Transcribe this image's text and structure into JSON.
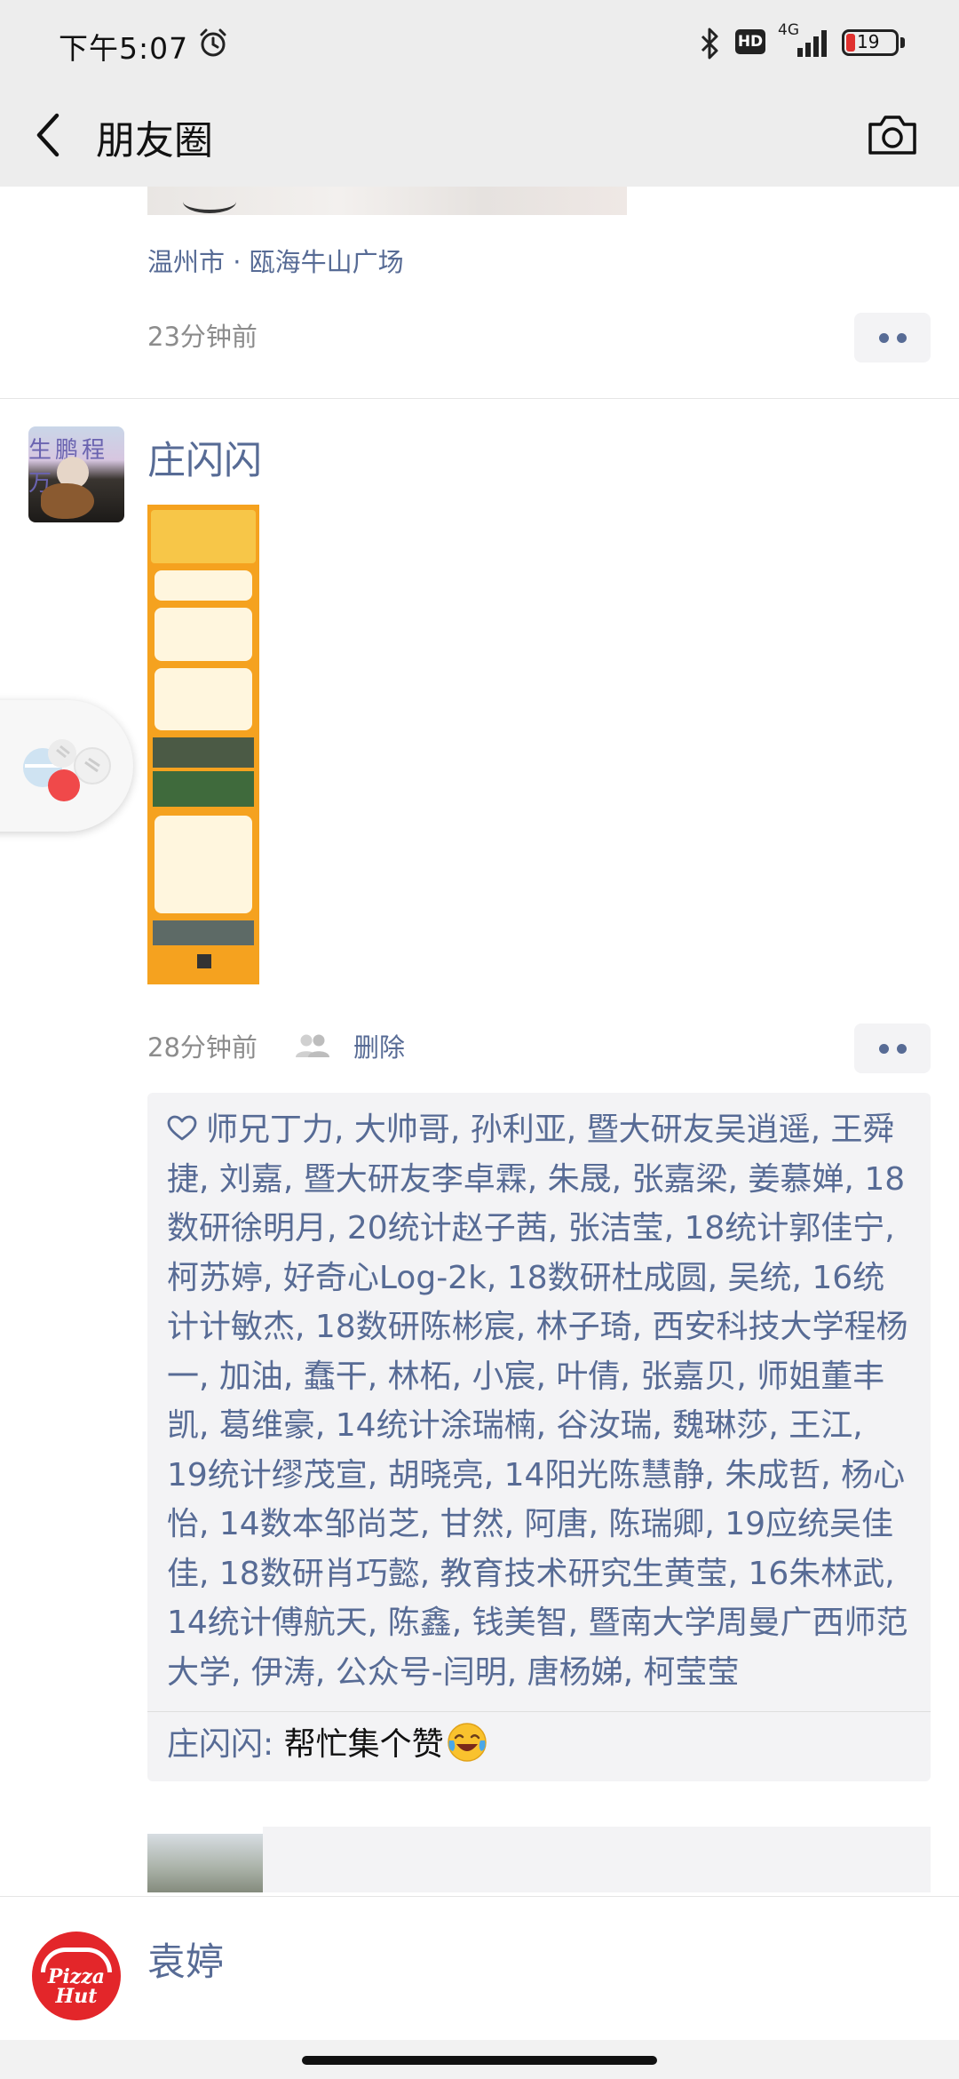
{
  "status_bar": {
    "time": "下午5:07",
    "hd": "HD",
    "network": "4G",
    "battery_level": "19"
  },
  "nav": {
    "title": "朋友圈"
  },
  "posts": [
    {
      "location": "温州市 · 瓯海牛山广场",
      "time_ago": "23分钟前"
    },
    {
      "author": "庄闪闪",
      "avatar_banner": "生鹏程万",
      "time_ago": "28分钟前",
      "delete_label": "删除",
      "likes": "师兄丁力, 大帅哥, 孙利亚, 暨大研友吴逍遥, 王舜捷, 刘嘉, 暨大研友李卓霖, 朱晟, 张嘉梁, 姜慕婵, 18数研徐明月, 20统计赵子茜, 张洁莹, 18统计郭佳宁, 柯苏婷, 好奇心Log-2k, 18数研杜成圆, 吴统, 16统计计敏杰, 18数研陈彬宸, 林子琦, 西安科技大学程杨一, 加油, 蠢干, 林柘, 小宸, 叶倩, 张嘉贝, 师姐董丰凯, 葛维豪, 14统计涂瑞楠, 谷汝瑞, 魏琳莎, 王江, 19统计缪茂宣, 胡晓亮, 14阳光陈慧静, 朱成哲, 杨心怡, 14数本邹尚芝, 甘然, 阿唐, 陈瑞卿, 19应统吴佳佳, 18数研肖巧懿, 教育技术研究生黄莹, 16朱林武, 14统计傅航天, 陈鑫, 钱美智, 暨南大学周曼广西师范大学, 伊涛, 公众号-闫明, 唐杨娣, 柯莹莹",
      "comment": {
        "author": "庄闪闪",
        "separator": ": ",
        "text": "帮忙集个赞"
      }
    },
    {
      "author": "袁婷",
      "avatar_logo": "Pizza Hut"
    }
  ],
  "icons": {
    "alarm": "alarm-clock-icon",
    "bluetooth": "bluetooth-icon",
    "back": "chevron-left-icon",
    "camera": "camera-icon",
    "heart": "heart-outline-icon",
    "friends": "friends-icon",
    "emoji": "laughing-crying-emoji-icon"
  },
  "colors": {
    "link": "#576b95",
    "header_bg": "#ededed",
    "box_bg": "#f3f3f5",
    "battery_low": "#e0312f",
    "pizza_red": "#e3262a"
  }
}
